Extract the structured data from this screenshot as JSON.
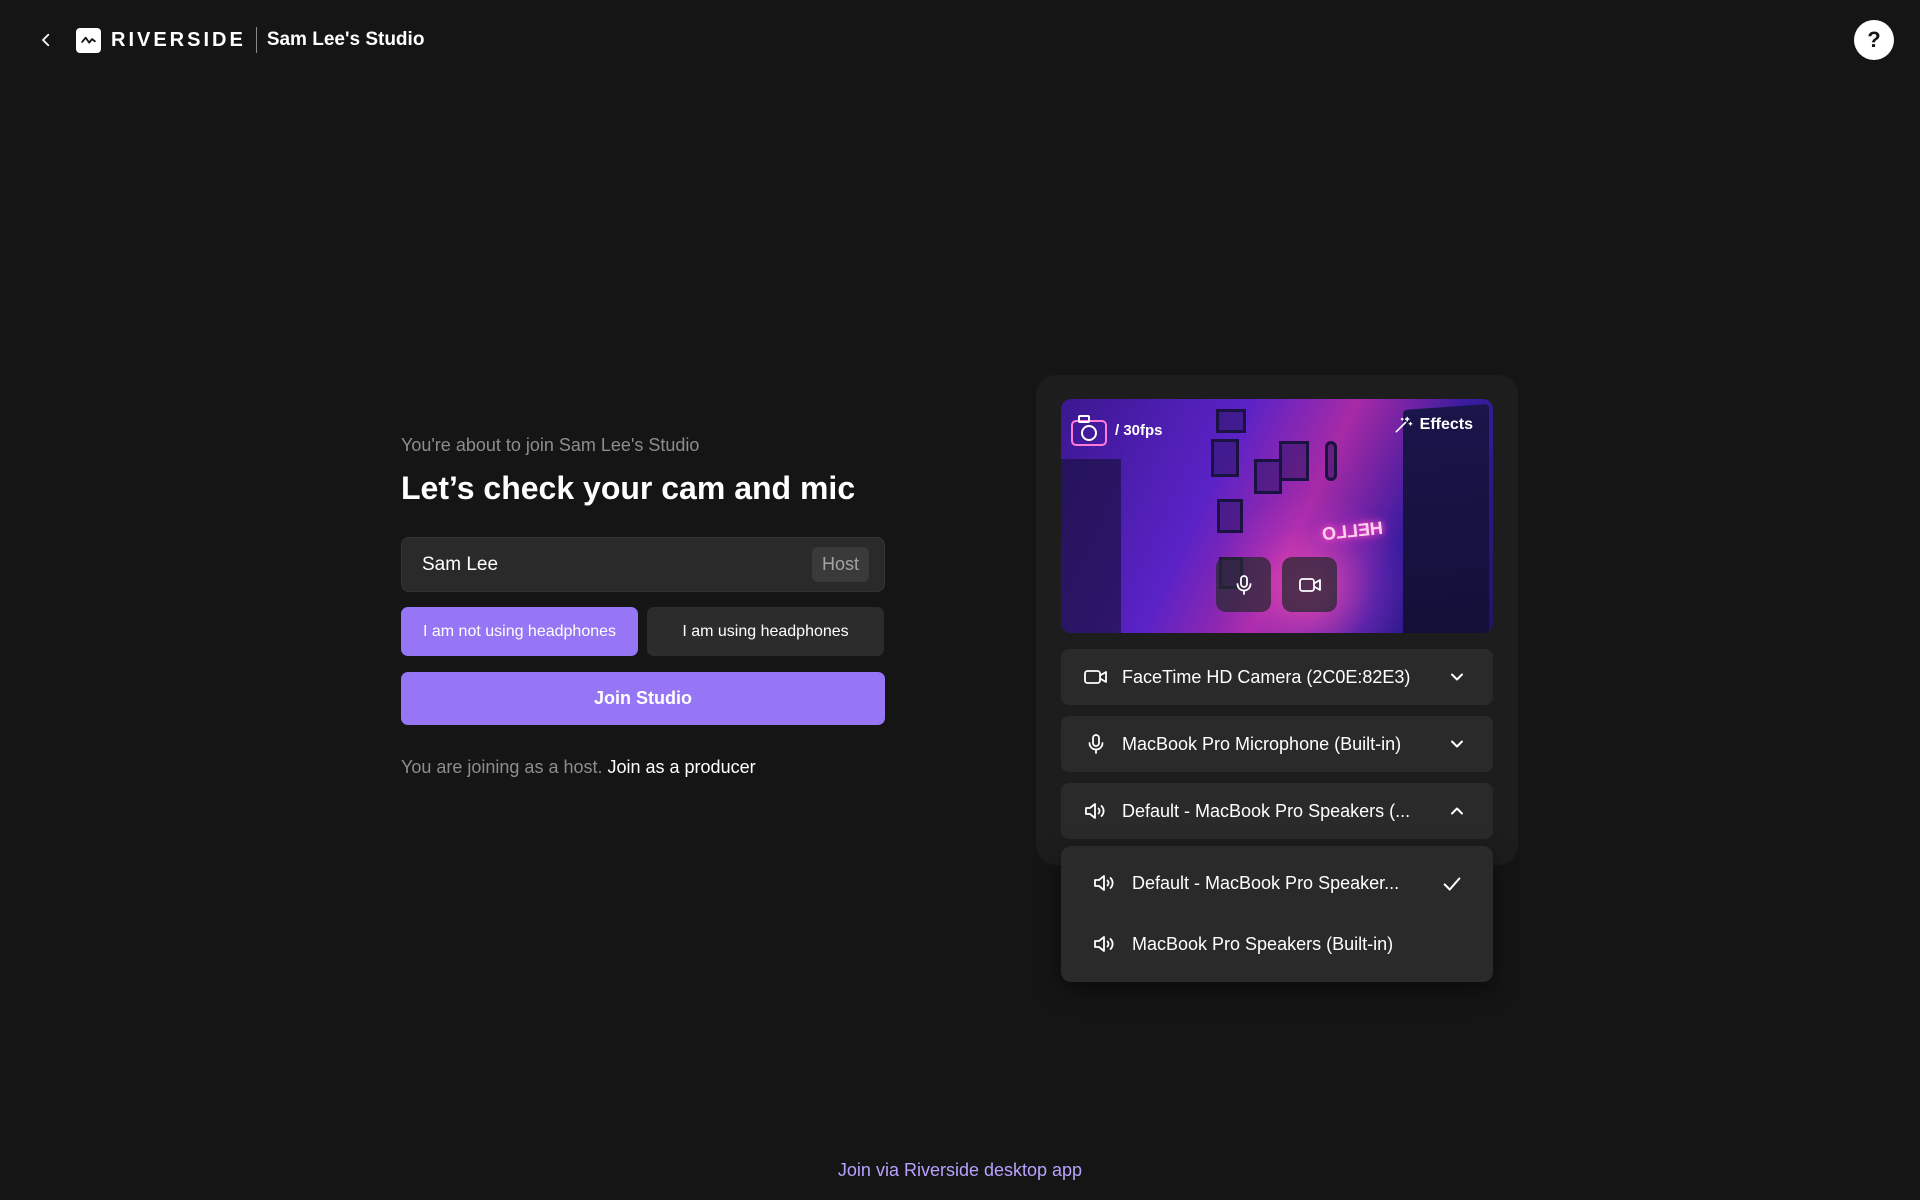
{
  "header": {
    "logo_text": "RIVERSIDE",
    "studio_name": "Sam Lee's Studio",
    "help_label": "?"
  },
  "join": {
    "subtitle": "You're about to join Sam Lee's Studio",
    "title": "Let’s check your cam and mic",
    "name_value": "Sam Lee",
    "role_tag": "Host",
    "headphones_off_label": "I am not using headphones",
    "headphones_on_label": "I am using headphones",
    "headphones_selected": "not_using",
    "join_button_label": "Join Studio",
    "joining_as_text": "You are joining as a host.",
    "producer_link_text": "Join as a producer"
  },
  "preview": {
    "resolution_text": "/ 30fps",
    "effects_label": "Effects",
    "neon_sign_text": "HELLO"
  },
  "devices": {
    "camera": "FaceTime HD Camera (2C0E:82E3)",
    "microphone": "MacBook Pro Microphone (Built-in)",
    "speaker": "Default - MacBook Pro Speakers (..."
  },
  "speaker_dropdown": {
    "options": [
      {
        "label": "Default - MacBook Pro Speaker...",
        "selected": true
      },
      {
        "label": "MacBook Pro Speakers (Built-in)",
        "selected": false
      }
    ]
  },
  "footer": {
    "desktop_link": "Join via Riverside desktop app"
  },
  "colors": {
    "background": "#151515",
    "accent": "#9676f5",
    "panel": "#1d1d1d",
    "field": "#2a2a2a",
    "link": "#b7a3ff"
  }
}
